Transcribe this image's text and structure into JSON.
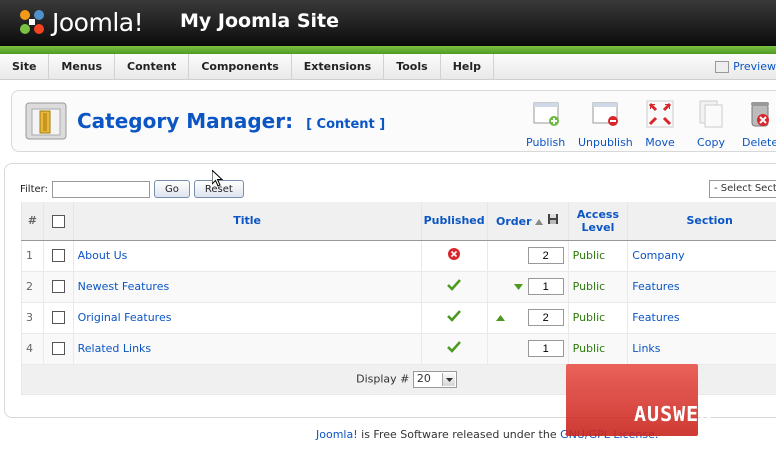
{
  "header": {
    "logo_text": "Joomla!",
    "site_title": "My Joomla Site"
  },
  "menubar": {
    "items": [
      "Site",
      "Menus",
      "Content",
      "Components",
      "Extensions",
      "Tools",
      "Help"
    ],
    "preview_label": "Preview"
  },
  "toolbar": {
    "title": "Category Manager:",
    "subtitle": "[ Content ]",
    "buttons": [
      {
        "label": "Publish",
        "icon": "publish-icon"
      },
      {
        "label": "Unpublish",
        "icon": "unpublish-icon"
      },
      {
        "label": "Move",
        "icon": "move-icon"
      },
      {
        "label": "Copy",
        "icon": "copy-icon"
      },
      {
        "label": "Delete",
        "icon": "delete-icon"
      }
    ]
  },
  "filter": {
    "label": "Filter:",
    "value": "",
    "go_label": "Go",
    "reset_label": "Reset",
    "section_select": "- Select Section -"
  },
  "table": {
    "headers": {
      "num": "#",
      "title": "Title",
      "published": "Published",
      "order": "Order",
      "access": "Access Level",
      "section": "Section"
    },
    "rows": [
      {
        "num": "1",
        "title": "About Us",
        "published": false,
        "order": "2",
        "up": false,
        "down": false,
        "access": "Public",
        "section": "Company"
      },
      {
        "num": "2",
        "title": "Newest Features",
        "published": true,
        "order": "1",
        "up": false,
        "down": true,
        "access": "Public",
        "section": "Features"
      },
      {
        "num": "3",
        "title": "Original Features",
        "published": true,
        "order": "2",
        "up": true,
        "down": false,
        "access": "Public",
        "section": "Features"
      },
      {
        "num": "4",
        "title": "Related Links",
        "published": true,
        "order": "1",
        "up": false,
        "down": false,
        "access": "Public",
        "section": "Links"
      }
    ],
    "display_label": "Display #",
    "display_value": "20"
  },
  "footer": {
    "link1": "Joomla!",
    "text": " is Free Software released under the ",
    "link2": "GNU/GPL License."
  },
  "watermark": {
    "text": "AUSWEB"
  },
  "colors": {
    "accent": "#0b55c4",
    "header_bg": "#111111",
    "green_bar": "#5eae2e",
    "published_green": "#4b9a1f",
    "unpublished_red": "#d8262b"
  }
}
